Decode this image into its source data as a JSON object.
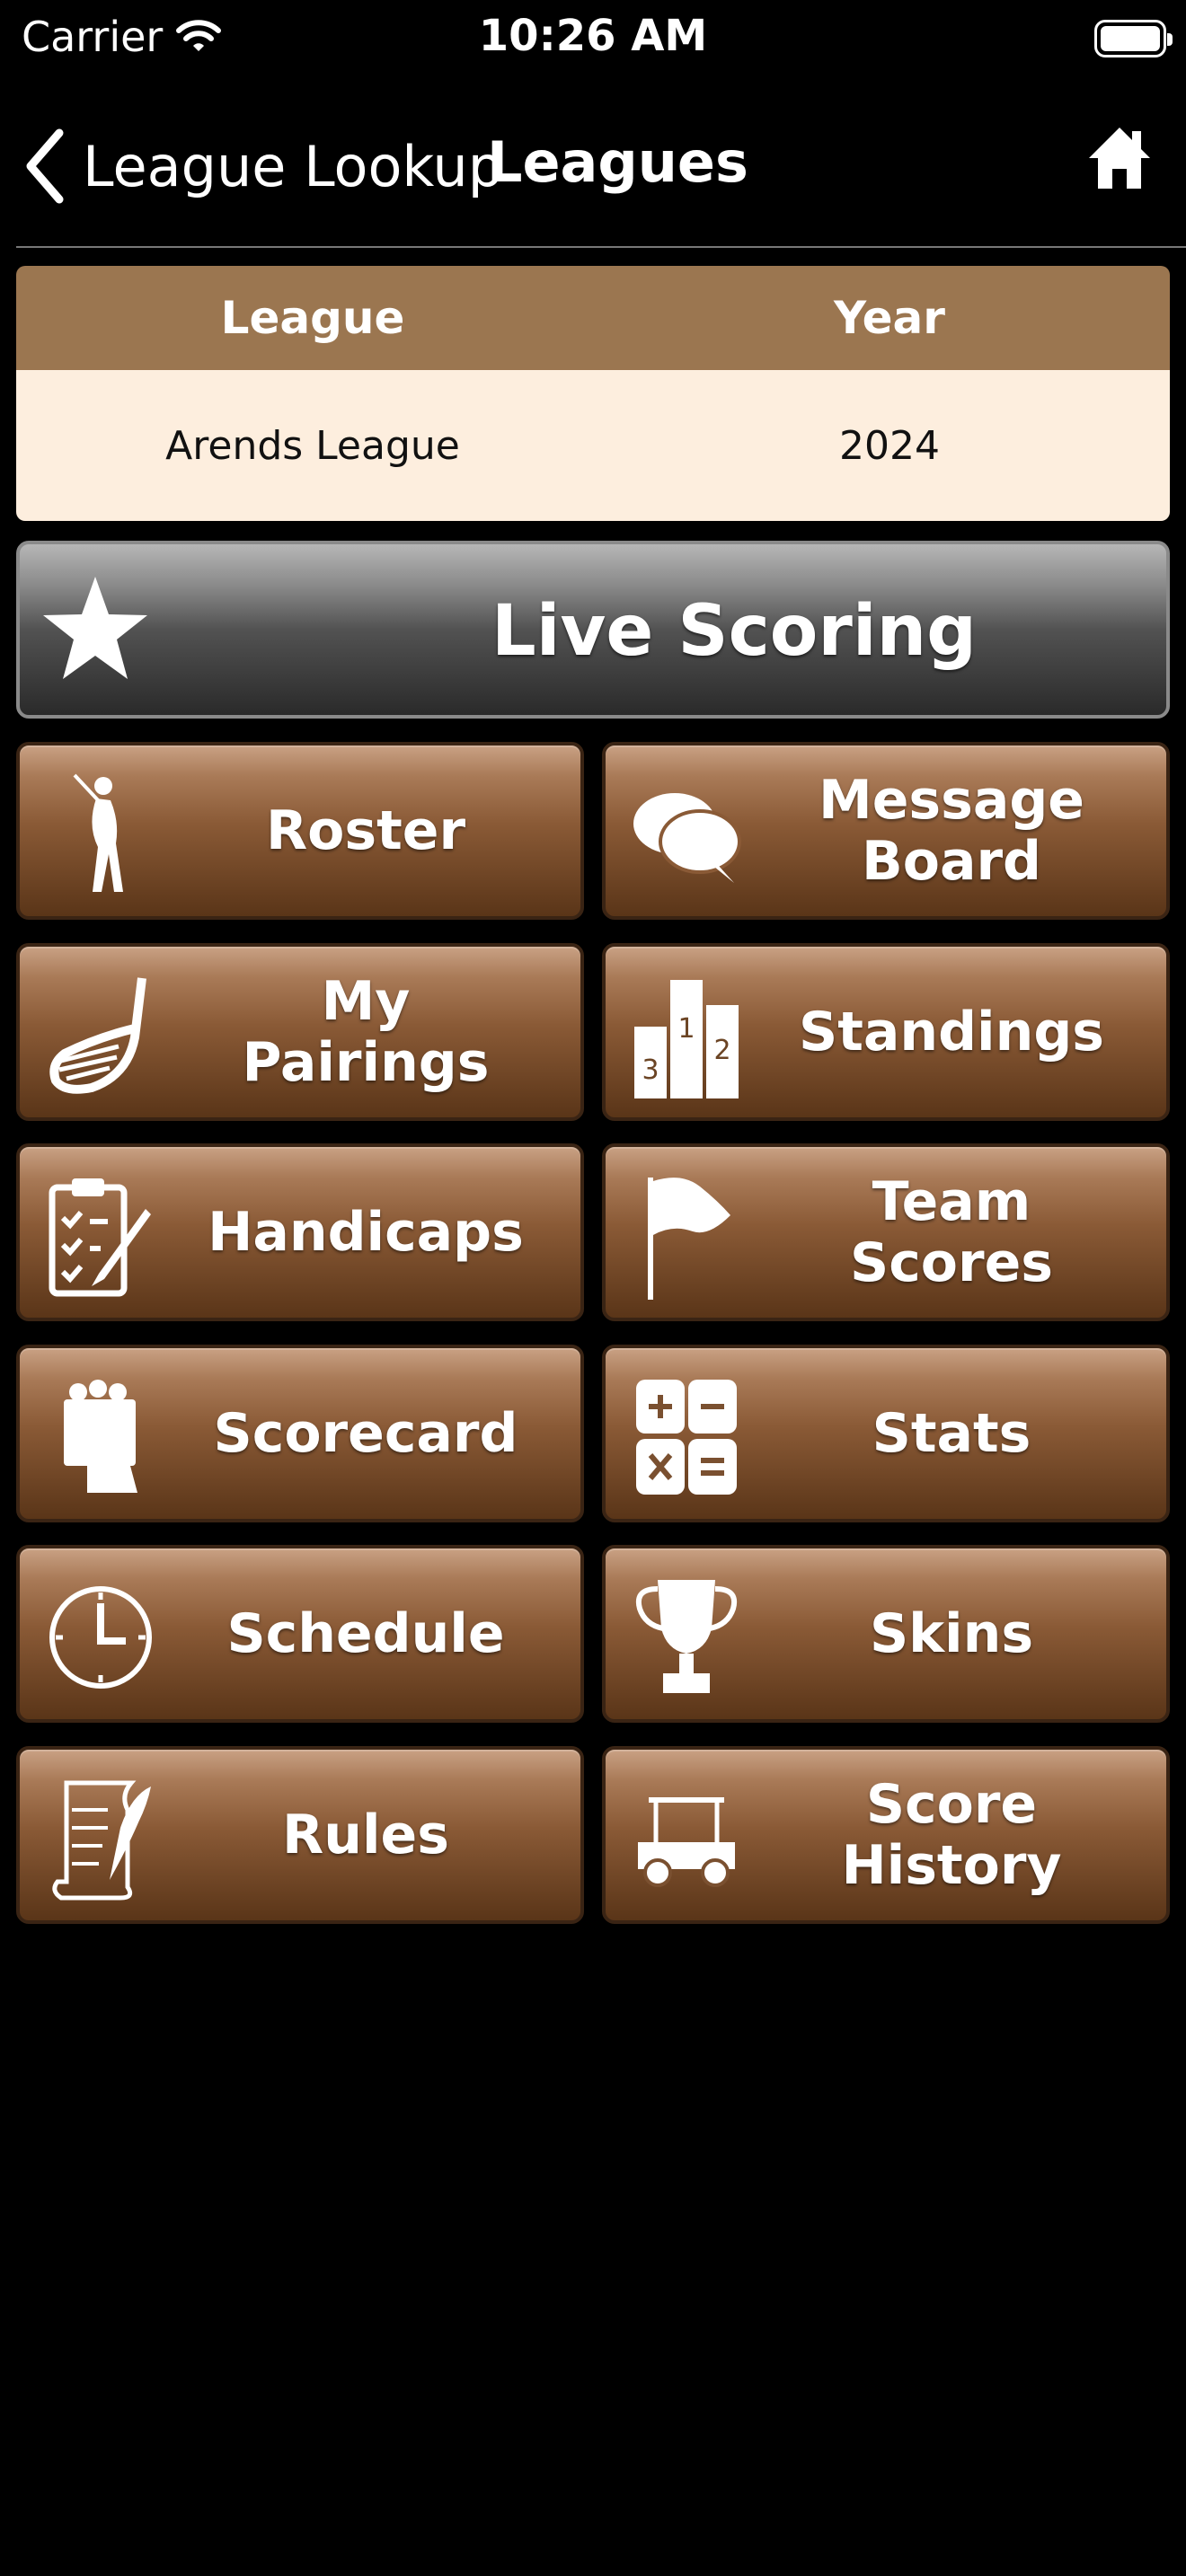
{
  "status_bar": {
    "carrier": "Carrier",
    "time": "10:26 AM"
  },
  "nav": {
    "back_label": "League Lookup",
    "title": "Leagues"
  },
  "table": {
    "headers": {
      "league": "League",
      "year": "Year"
    },
    "row": {
      "league": "Arends League",
      "year": "2024"
    }
  },
  "live_scoring": {
    "label": "Live Scoring"
  },
  "buttons": {
    "roster": "Roster",
    "message_board": "Message\nBoard",
    "my_pairings": "My\nPairings",
    "standings": "Standings",
    "handicaps": "Handicaps",
    "team_scores": "Team\nScores",
    "scorecard": "Scorecard",
    "stats": "Stats",
    "schedule": "Schedule",
    "skins": "Skins",
    "rules": "Rules",
    "score_history": "Score\nHistory"
  },
  "standings_icon_numbers": {
    "first": "1",
    "second": "2",
    "third": "3"
  },
  "colors": {
    "table_header": "#9b7650",
    "table_row": "#fdeede",
    "button_brown": "#8a5a36",
    "live_gray": "#525252"
  }
}
